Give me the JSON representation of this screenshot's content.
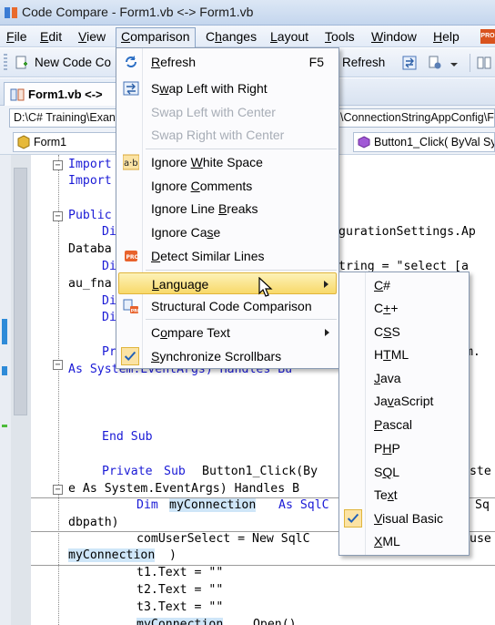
{
  "window": {
    "title": "Code Compare - Form1.vb <-> Form1.vb"
  },
  "menubar": {
    "items": [
      {
        "label": "File",
        "ul": "F"
      },
      {
        "label": "Edit",
        "ul": "E"
      },
      {
        "label": "View",
        "ul": "V"
      },
      {
        "label": "Comparison",
        "ul": "C"
      },
      {
        "label": "Changes",
        "ul": "h"
      },
      {
        "label": "Layout",
        "ul": "L"
      },
      {
        "label": "Tools",
        "ul": "T"
      },
      {
        "label": "Window",
        "ul": "W"
      },
      {
        "label": "Help",
        "ul": "H"
      }
    ],
    "badge": "PRO"
  },
  "toolbar": {
    "new_code_label": "New Code Co",
    "refresh_label": "Refresh"
  },
  "tab": {
    "label": "Form1.vb <->"
  },
  "paths": {
    "left": "D:\\C# Training\\Exan",
    "right": "\\ConnectionStringAppConfig\\Fo"
  },
  "selectors": {
    "left": "Form1",
    "right": "Button1_Click( ByVal Sy"
  },
  "code": {
    "l1a": "Import",
    "l2a": "Import",
    "l3a": "Public",
    "l4b": "Di",
    "l4c": "gurationSettings.Ap",
    "l5a": "Databa",
    "l6b": "Di",
    "l6c": "tring = \"select [a",
    "l7a": "au_fna",
    "l8b": "Di",
    "l9b": "Di",
    "l10b": "Pr",
    "l10c": "em.",
    "l11a": "As System.EventArgs) Handles Bu",
    "end_sub": "End Sub",
    "private": "Private",
    "sub": "Sub",
    "button_click": "Button1_Click(By",
    "byval_tail": "yste",
    "e_as": "e As System.EventArgs) Handles B",
    "dim": "Dim",
    "myconn": "myConnection",
    "as_sqlc": "As SqlC",
    "sq": "Sq",
    "dbpath": "dbpath)",
    "cmd": "comUserSelect = New SqlC",
    "use": "use",
    "myconn2": "myConnection",
    "paren": ")",
    "t1": "t1.Text = \"\"",
    "t2": "t2.Text = \"\"",
    "t3": "t3.Text = \"\"",
    "open_prefix": "myConnection",
    "open_suffix": ".Open()"
  },
  "comparison_menu": {
    "items": [
      {
        "label": "Refresh",
        "ul": "R",
        "shortcut": "F5",
        "enabled": true
      },
      {
        "label": "Swap Left with Right",
        "ul": "w",
        "enabled": true
      },
      {
        "label": "Swap Left with Center",
        "enabled": false
      },
      {
        "label": "Swap Right with Center",
        "enabled": false
      },
      {
        "label": "Ignore White Space",
        "ul": "W",
        "enabled": true
      },
      {
        "label": "Ignore Comments",
        "ul": "C",
        "enabled": true
      },
      {
        "label": "Ignore Line Breaks",
        "ul": "B",
        "enabled": true
      },
      {
        "label": "Ignore Case",
        "ul": "s",
        "enabled": true
      },
      {
        "label": "Detect Similar Lines",
        "ul": "D",
        "enabled": true
      },
      {
        "label": "Language",
        "ul": "L",
        "enabled": true,
        "submenu": true,
        "highlighted": true
      },
      {
        "label": "Structural Code Comparison",
        "enabled": true
      },
      {
        "label": "Compare Text",
        "ul": "o",
        "enabled": true,
        "submenu": true
      },
      {
        "label": "Synchronize Scrollbars",
        "ul": "S",
        "enabled": true,
        "checked": true
      }
    ]
  },
  "language_menu": {
    "items": [
      {
        "label": "C#",
        "ul": "C"
      },
      {
        "label": "C++",
        "ul": "+"
      },
      {
        "label": "CSS",
        "ul": "S"
      },
      {
        "label": "HTML",
        "ul": "T"
      },
      {
        "label": "Java",
        "ul": "J"
      },
      {
        "label": "JavaScript",
        "ul": "v"
      },
      {
        "label": "Pascal",
        "ul": "P"
      },
      {
        "label": "PHP",
        "ul": "H"
      },
      {
        "label": "SQL",
        "ul": "Q"
      },
      {
        "label": "Text",
        "ul": "x"
      },
      {
        "label": "Visual Basic",
        "ul": "V",
        "checked": true
      },
      {
        "label": "XML",
        "ul": "X"
      }
    ]
  },
  "colors": {
    "keyword": "#1a1ad6",
    "highlight": "#cfe6f8",
    "menu_hover": "#f8d96a",
    "accent": "#2e8bd8"
  },
  "icons": [
    "refresh-icon",
    "swap-icon",
    "ignore-whitespace-icon",
    "pro-icon",
    "structural-compare-icon",
    "checkmark-icon",
    "cursor-icon"
  ]
}
